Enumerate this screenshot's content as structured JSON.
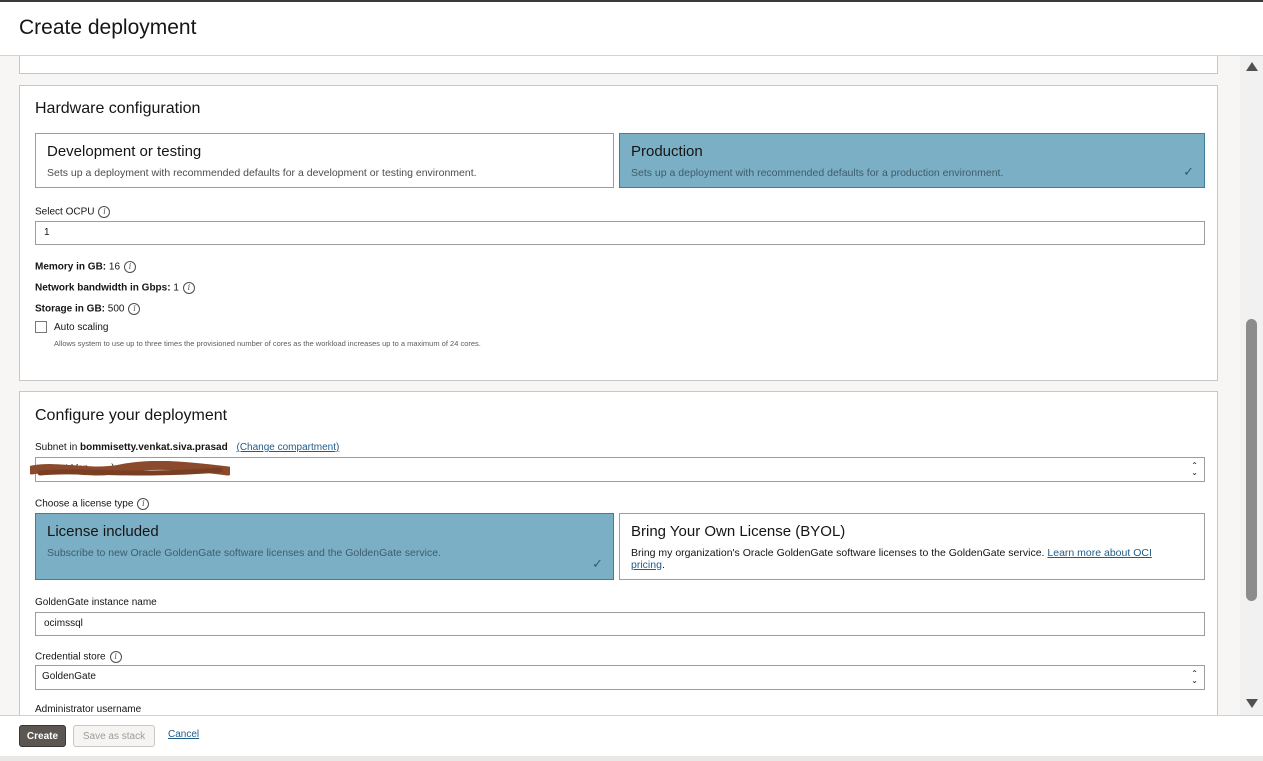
{
  "header": {
    "title": "Create deployment"
  },
  "hardware": {
    "title": "Hardware configuration",
    "options": [
      {
        "title": "Development or testing",
        "description": "Sets up a deployment with recommended defaults for a development or testing environment.",
        "selected": false
      },
      {
        "title": "Production",
        "description": "Sets up a deployment with recommended defaults for a production environment.",
        "selected": true
      }
    ],
    "ocpu_label": "Select OCPU",
    "ocpu_value": "1",
    "memory_label": "Memory in GB:",
    "memory_value": "16",
    "network_label": "Network bandwidth in Gbps:",
    "network_value": "1",
    "storage_label": "Storage in GB:",
    "storage_value": "500",
    "autoscaling_label": "Auto scaling",
    "autoscaling_checked": false,
    "autoscaling_help": "Allows system to use up to three times the provisioned number of cores as the workload increases up to a maximum of 24 cores."
  },
  "configure": {
    "title": "Configure your deployment",
    "subnet_label_prefix": "Subnet in",
    "subnet_compartment": "bommisetty.venkat.siva.prasad",
    "change_compartment": "(Change compartment)",
    "subnet_value_visible": "…net-Vcn…                    …)",
    "license_label": "Choose a license type",
    "license_options": [
      {
        "title": "License included",
        "description": "Subscribe to new Oracle GoldenGate software licenses and the GoldenGate service.",
        "selected": true
      },
      {
        "title": "Bring Your Own License (BYOL)",
        "description": "Bring my organization's Oracle GoldenGate software licenses to the GoldenGate service.",
        "link": "Learn more about OCI pricing",
        "selected": false
      }
    ],
    "instance_label": "GoldenGate instance name",
    "instance_value": "ocimssql",
    "credential_label": "Credential store",
    "credential_value": "GoldenGate",
    "admin_label": "Administrator username"
  },
  "footer": {
    "create": "Create",
    "save_stack": "Save as stack",
    "cancel": "Cancel"
  },
  "colors": {
    "selected_card": "#7aafc5",
    "primary_button": "#5b5652",
    "link": "#1f5c8a"
  }
}
